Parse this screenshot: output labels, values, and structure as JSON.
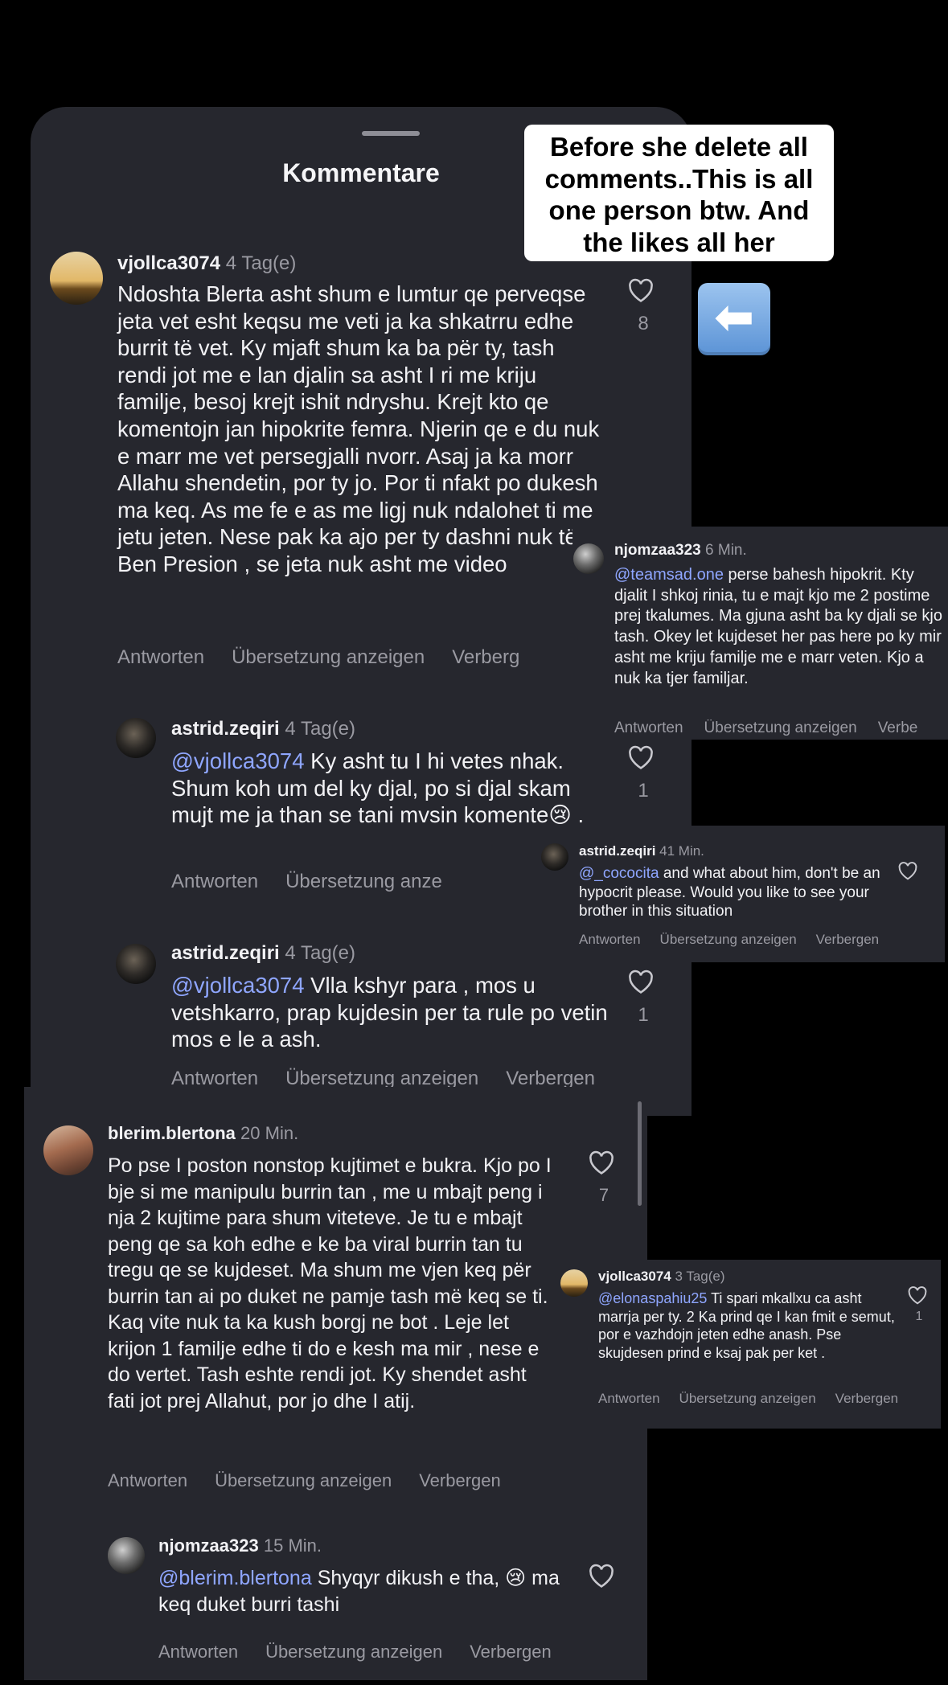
{
  "callout": {
    "lines": [
      "Before she delete all",
      "comments..This is all",
      "one person btw. And",
      "the likes all her"
    ],
    "arrow_icon": "left-arrow-emoji"
  },
  "sheet": {
    "title": "Kommentare"
  },
  "actions": {
    "reply": "Antworten",
    "translate": "Übersetzung anzeigen",
    "hide": "Verbergen",
    "hide_cut": "Verberg",
    "hide_cut2": "Verbe",
    "translate_cut": "Übersetzung anze"
  },
  "comments": [
    {
      "user": "vjollca3074",
      "time": "4 Tag(e)",
      "text": "Ndoshta Blerta asht shum e lumtur qe perveqse jeta vet esht keqsu me veti ja ka shkatrru edhe burrit të vet. Ky mjaft shum ka ba për ty, tash rendi jot me e lan djalin sa asht I ri me kriju familje, besoj krejt ishit ndryshu. Krejt kto qe komentojn jan hipokrite femra. Njerin qe e du nuk e marr me vet persegjalli nvorr.  Asaj ja ka morr Allahu shendetin, por ty jo.  Por ti nfakt po dukesh ma keq. As me fe e as me ligj nuk ndalohet ti me jetu jeten. Nese pak ka ajo per ty dashni nuk të Ben Presion , se jeta nuk asht me video",
      "likes": "8"
    },
    {
      "user": "astrid.zeqiri",
      "time": "4 Tag(e)",
      "mention": "@vjollca3074",
      "text": " Ky asht tu I hi vetes nhak. Shum koh um del ky djal, po si djal skam mujt me ja than se tani mvsin komente😢 .",
      "likes": "1"
    },
    {
      "user": "astrid.zeqiri",
      "time": "4 Tag(e)",
      "mention": "@vjollca3074",
      "text": " Vlla kshyr para , mos u vetshkarro, prap kujdesin per ta rule po vetin mos e le a ash.",
      "likes": "1"
    },
    {
      "user": "blerim.blertona",
      "time": "20 Min.",
      "text": "Po pse I poston nonstop kujtimet e bukra. Kjo po I bje si me manipulu burrin tan , me u mbajt peng i nja 2 kujtime para shum viteteve. Je tu e mbajt peng qe sa koh edhe e ke ba viral burrin tan  tu tregu qe se kujdeset. Ma shum me vjen keq për burrin tan ai po duket ne pamje tash më keq se ti. Kaq vite nuk ta ka kush borgj ne bot . Leje let krijon 1 familje edhe ti do e kesh ma mir , nese e do vertet. Tash eshte rendi jot.  Ky shendet asht fati jot prej Allahut, por jo dhe I atij.",
      "likes": "7"
    },
    {
      "user": "njomzaa323",
      "time": "15 Min.",
      "mention": "@blerim.blertona",
      "text": " Shyqyr dikush e tha, 😢 ma keq duket burri tashi"
    }
  ],
  "overlays": [
    {
      "user": "njomzaa323",
      "time": "6 Min.",
      "mention": "@teamsad.one",
      "text": "  perse bahesh hipokrit. Kty djalit I shkoj rinia, tu e majt kjo me 2 postime prej tkalumes. Ma gjuna asht ba ky djali se kjo tash. Okey let kujdeset her pas here po ky mir asht me kriju familje me e marr veten. Kjo a nuk ka tjer familjar."
    },
    {
      "user": "astrid.zeqiri",
      "time": "41 Min.",
      "mention": "@_cococita",
      "text": " and what about him, don't be an hypocrit please. Would you like to see your brother in this situation"
    },
    {
      "user": "vjollca3074",
      "time": "3 Tag(e)",
      "mention": "@elonaspahiu25",
      "text": "  Ti spari mkallxu ca asht marrja per ty.  2 Ka prind qe I kan fmit e semut, por e vazhdojn jeten edhe anash. Pse skujdesen prind e ksaj pak per ket .",
      "likes": "1"
    }
  ]
}
